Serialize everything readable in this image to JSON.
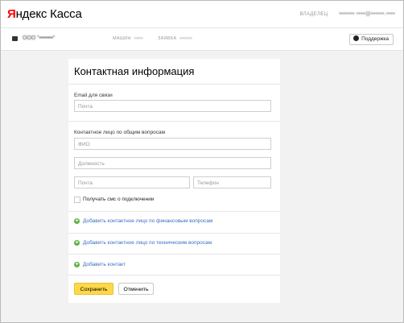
{
  "header": {
    "logo_part1": "Я",
    "logo_part2": "ндекс Касса",
    "owner_label": "ВЛАДЕЛЕЦ",
    "owner_value": "••••••• ••••@••••••.••••"
  },
  "subheader": {
    "shop_name": "ООО \"•••••••\"",
    "shop_id_label": "МАШИН",
    "shop_id_value": "•••••",
    "request_label": "ЗАЯВКА",
    "request_value": "•••••••",
    "support_label": "Поддержка"
  },
  "form": {
    "title": "Контактная информация",
    "email": {
      "label": "Email для связи",
      "placeholder": "Почта"
    },
    "general_contact": {
      "label": "Контактное лицо по общим вопросам",
      "name_placeholder": "ФИО",
      "position_placeholder": "Должность",
      "email_placeholder": "Почта",
      "phone_placeholder": "Телефон"
    },
    "sms_checkbox_label": "Получать смс о подключении",
    "add_links": [
      "Добавить контактное лицо по финансовым вопросам",
      "Добавить контактное лицо по техническим вопросам",
      "Добавить контакт"
    ],
    "save_label": "Сохранить",
    "cancel_label": "Отменить"
  },
  "colors": {
    "logo_red": "#ff0000",
    "link_blue": "#3a6ec6",
    "plus_green": "#5cb33a",
    "primary_yellow": "#ffd84a"
  }
}
